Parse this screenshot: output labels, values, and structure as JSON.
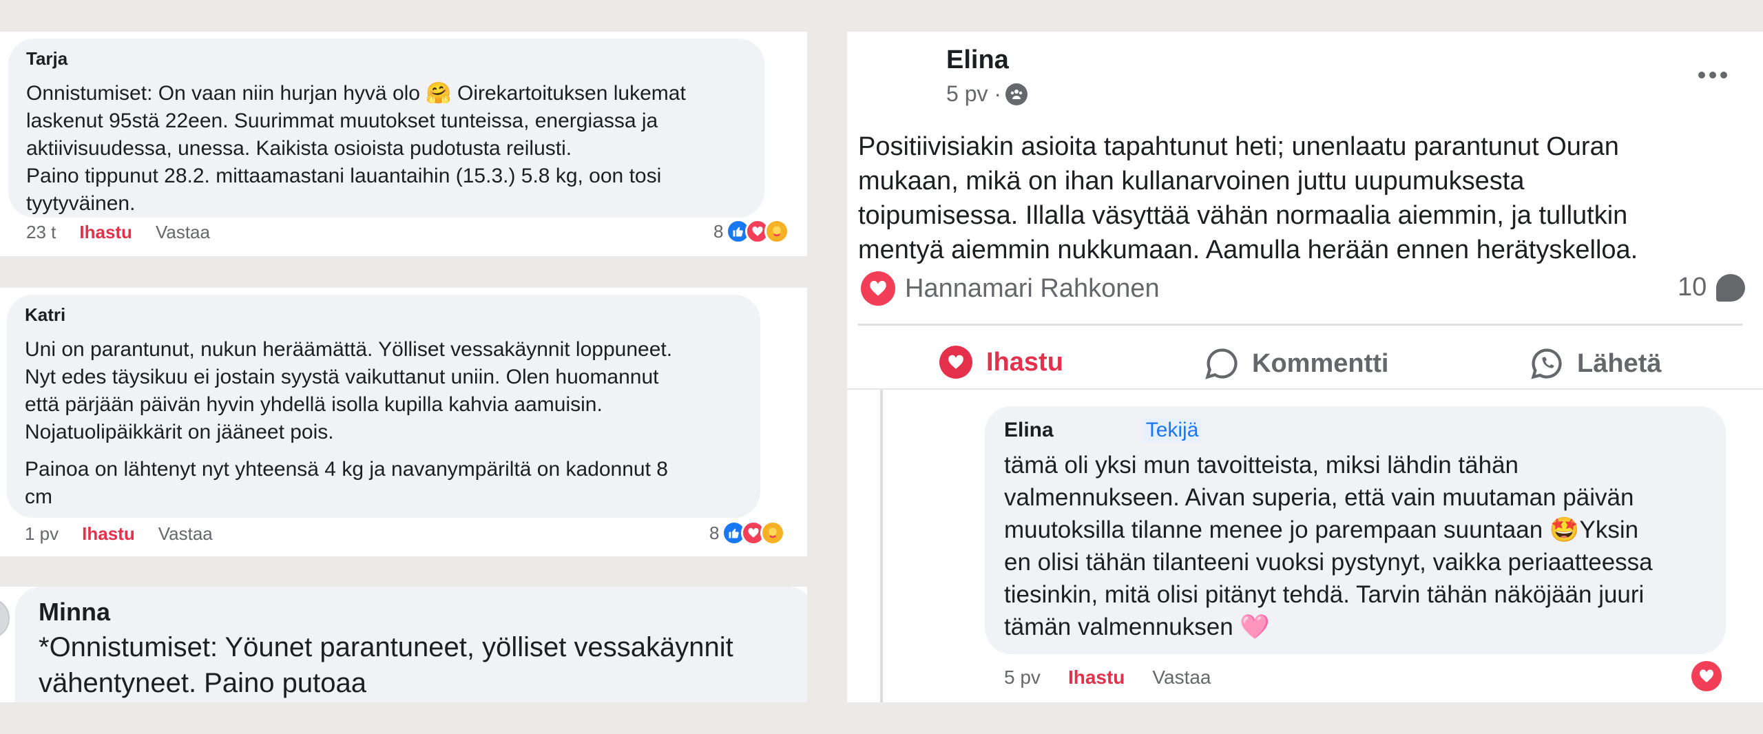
{
  "left_comments": [
    {
      "author": "Tarja",
      "text": "Onnistumiset: On vaan niin hurjan hyvä olo 🤗 Oirekartoituksen lukemat\nlaskenut 95stä 22een. Suurimmat muutokset tunteissa, energiassa ja\naktiivisuudessa, unessa. Kaikista osioista pudotusta reilusti.\nPaino tippunut 28.2. mittaamastani lauantaihin (15.3.) 5.8 kg, oon tosi\ntyytyväinen.",
      "time": "23 t",
      "like_label": "Ihastu",
      "reply_label": "Vastaa",
      "reaction_count": "8"
    },
    {
      "author": "Katri",
      "text": "Uni on parantunut, nukun heräämättä. Yölliset vessakäynnit loppuneet.\nNyt edes täysikuu ei jostain syystä vaikuttanut uniin. Olen huomannut\nettä pärjään päivän hyvin yhdellä isolla kupilla kahvia aamuisin.\nNojatuolipäikkärit on jääneet pois.",
      "text2": "Painoa on lähtenyt nyt yhteensä 4 kg ja navanympäriltä on kadonnut 8\ncm",
      "time": "1 pv",
      "like_label": "Ihastu",
      "reply_label": "Vastaa",
      "reaction_count": "8"
    },
    {
      "author": "Minna",
      "text": "*Onnistumiset: Yöunet parantuneet, yölliset vessakäynnit\nvähentyneet. Paino putoaa"
    }
  ],
  "post": {
    "author": "Elina",
    "time": "5 pv ·",
    "audience_icon": "group-icon",
    "text": "Positiivisiakin asioita tapahtunut heti; unenlaatu parantunut Ouran\nmukaan, mikä on ihan kullanarvoinen juttu uupumuksesta\ntoipumisessa. Illalla väsyttää vähän normaalia aiemmin, ja tullutkin\nmentyä aiemmin nukkumaan. Aamulla herään ennen herätyskelloa.",
    "reactor": "Hannamari Rahkonen",
    "comment_count": "10",
    "actions": {
      "like": "Ihastu",
      "comment": "Kommentti",
      "share": "Lähetä"
    },
    "reply": {
      "author": "Elina",
      "badge": "Tekijä",
      "text": "tämä oli yksi mun tavoitteista, miksi lähdin tähän\nvalmennukseen. Aivan superia, että vain muutaman päivän\nmuutoksilla tilanne menee jo parempaan suuntaan 🤩Yksin\nen olisi tähän tilanteeni vuoksi pystynyt, vaikka periaatteessa\ntiesinkin, mitä olisi pitänyt tehdä. Tarvin tähän näköjään juuri\ntämän valmennuksen 🩷",
      "time": "5 pv",
      "like_label": "Ihastu",
      "reply_label": "Vastaa"
    }
  },
  "colors": {
    "like_red": "#e4304b",
    "bubble": "#f0f2f5",
    "background": "#ebeae6",
    "badge_blue": "#1877f2"
  }
}
